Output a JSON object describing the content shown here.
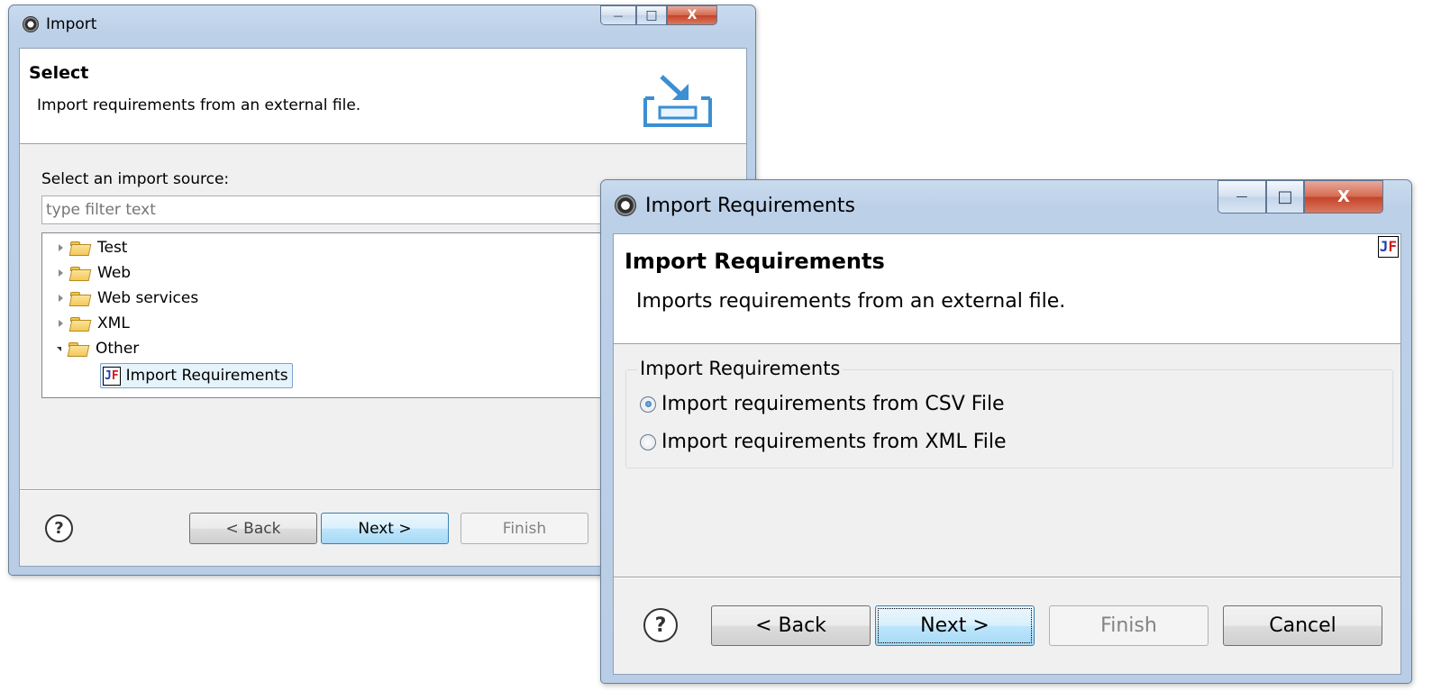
{
  "import_dialog": {
    "title": "Import",
    "banner_title": "Select",
    "banner_desc": "Import requirements from an external file.",
    "source_label": "Select an import source:",
    "filter_placeholder": "type filter text",
    "tree": [
      {
        "label": "Test",
        "expanded": false
      },
      {
        "label": "Web",
        "expanded": false
      },
      {
        "label": "Web services",
        "expanded": false
      },
      {
        "label": "XML",
        "expanded": false
      },
      {
        "label": "Other",
        "expanded": true
      }
    ],
    "selected_item": "Import Requirements",
    "buttons": {
      "back": "< Back",
      "next": "Next >",
      "finish": "Finish"
    }
  },
  "req_dialog": {
    "title": "Import Requirements",
    "banner_title": "Import Requirements",
    "banner_desc": "Imports requirements from an external file.",
    "group_label": "Import Requirements",
    "options": [
      {
        "label": "Import requirements from CSV File",
        "selected": true
      },
      {
        "label": "Import requirements from XML File",
        "selected": false
      }
    ],
    "buttons": {
      "back": "< Back",
      "next": "Next >",
      "finish": "Finish",
      "cancel": "Cancel"
    }
  },
  "icons": {
    "help": "?",
    "req_icon_j": "J",
    "req_icon_f": "F",
    "minimize": "—",
    "maximize": "□",
    "close": "X"
  },
  "colors": {
    "selection_bg": "#e5f3fb",
    "selection_border": "#7da2ce",
    "close_red": "#c5432a"
  }
}
